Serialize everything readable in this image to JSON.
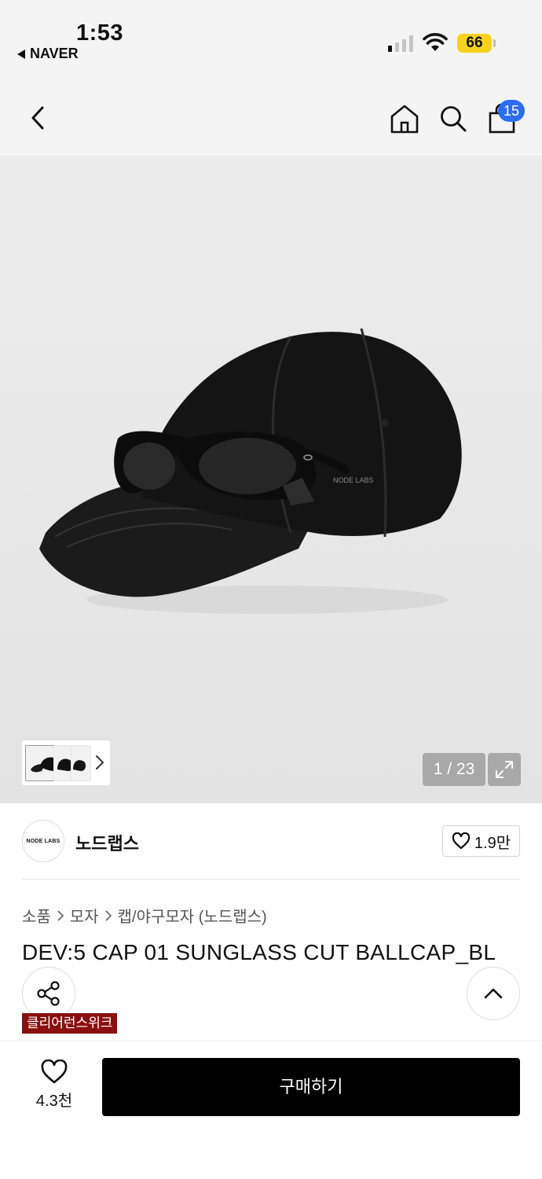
{
  "status_bar": {
    "time": "1:53",
    "back_app": "NAVER",
    "battery": "66"
  },
  "nav": {
    "cart_count": "15"
  },
  "gallery": {
    "counter": "1 / 23",
    "watermark": "NODE LABS"
  },
  "brand": {
    "logo_text": "NODE LABS",
    "name": "노드랩스",
    "likes": "1.9만"
  },
  "breadcrumb": [
    "소품",
    "모자",
    "캡/야구모자 (노드랩스)"
  ],
  "product": {
    "title": "DEV:5 CAP 01 SUNGLASS CUT BALLCAP_BL",
    "tag": "클리어런스위크"
  },
  "bottom": {
    "wish_count": "4.3천",
    "buy_label": "구매하기"
  },
  "colors": {
    "badge_blue": "#2b6df5",
    "tag_red": "#8a0f0f",
    "battery_yellow": "#f7d21c",
    "buy_black": "#000000"
  }
}
